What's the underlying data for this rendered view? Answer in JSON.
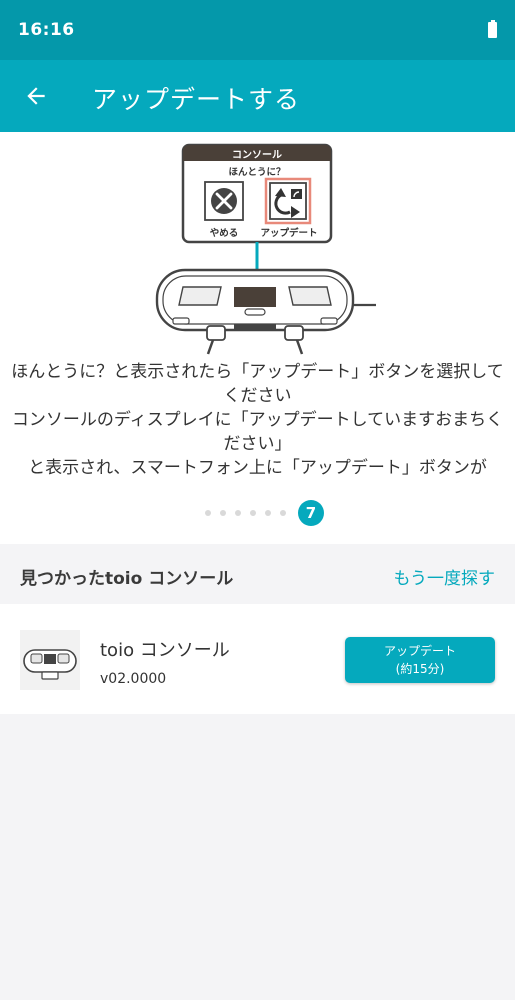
{
  "status_bar": {
    "time": "16:16"
  },
  "app_bar": {
    "title": "アップデートする"
  },
  "illustration": {
    "console_label": "コンソール",
    "question": "ほんとうに？",
    "cancel_label": "やめる",
    "update_label": "アップデート"
  },
  "tutorial": {
    "lines": [
      "ほんとうに？と表示されたら「アップデート」ボタンを選択してください",
      "コンソールのディスプレイに「アップデートしていますおまちください」",
      "と表示され、スマートフォン上に「アップデート」ボタンが"
    ],
    "current_step": "7",
    "total_dots": 7
  },
  "found": {
    "title": "見つかったtoio コンソール",
    "search_again": "もう一度探す"
  },
  "device": {
    "name": "toio コンソール",
    "version": "v02.0000",
    "update_button_line1": "アップデート",
    "update_button_line2": "(約15分)"
  },
  "colors": {
    "status_bar": "#0498aa",
    "app_bar": "#05a9bd",
    "accent": "#05a9bd",
    "highlight": "#e8897a"
  },
  "icons": {
    "back": "arrow-left-icon",
    "battery": "battery-icon",
    "cancel": "x-circle-icon",
    "update": "update-arrows-icon"
  }
}
